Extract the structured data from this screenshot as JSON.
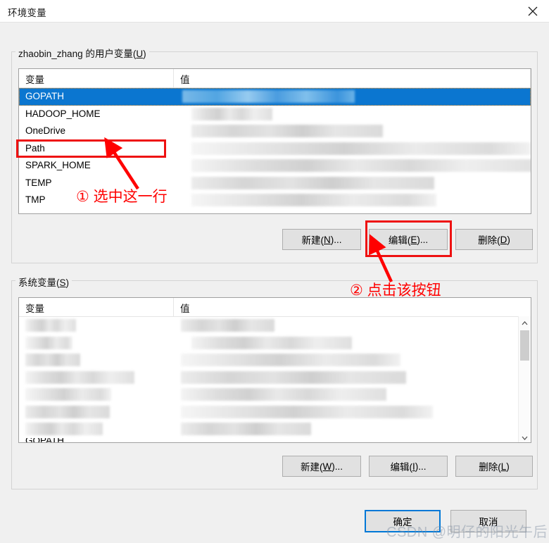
{
  "window": {
    "title": "环境变量",
    "close_icon": "close-icon"
  },
  "user_section": {
    "legend_prefix": "zhaobin_zhang 的用户变量(",
    "legend_accel": "U",
    "legend_suffix": ")",
    "columns": [
      "变量",
      "值"
    ],
    "rows": [
      {
        "name": "GOPATH",
        "value": "",
        "selected": true
      },
      {
        "name": "HADOOP_HOME",
        "value": "",
        "selected": false
      },
      {
        "name": "OneDrive",
        "value": "",
        "selected": false
      },
      {
        "name": "Path",
        "value": "",
        "selected": false
      },
      {
        "name": "SPARK_HOME",
        "value": "",
        "selected": false
      },
      {
        "name": "TEMP",
        "value": "",
        "selected": false
      },
      {
        "name": "TMP",
        "value": "",
        "selected": false
      }
    ],
    "buttons": {
      "new": {
        "prefix": "新建(",
        "accel": "N",
        "suffix": ")..."
      },
      "edit": {
        "prefix": "编辑(",
        "accel": "E",
        "suffix": ")..."
      },
      "delete": {
        "prefix": "删除(",
        "accel": "D",
        "suffix": ")"
      }
    }
  },
  "system_section": {
    "legend_prefix": "系统变量(",
    "legend_accel": "S",
    "legend_suffix": ")",
    "columns": [
      "变量",
      "值"
    ],
    "rows": [
      {
        "name": "",
        "value": "",
        "censored": true
      },
      {
        "name": "",
        "value": "",
        "censored": true
      },
      {
        "name": "",
        "value": "",
        "censored": true
      },
      {
        "name": "",
        "value": "",
        "censored": true
      },
      {
        "name": "",
        "value": "",
        "censored": true
      },
      {
        "name": "",
        "value": "",
        "censored": true
      },
      {
        "name": "GOPATH",
        "value": "",
        "censored": false
      }
    ],
    "buttons": {
      "new": {
        "prefix": "新建(",
        "accel": "W",
        "suffix": ")..."
      },
      "edit": {
        "prefix": "编辑(",
        "accel": "I",
        "suffix": ")..."
      },
      "delete": {
        "prefix": "删除(",
        "accel": "L",
        "suffix": ")"
      }
    },
    "scrollbar": {
      "up_icon": "chevron-up-icon",
      "down_icon": "chevron-down-icon"
    }
  },
  "dialog_buttons": {
    "ok": "确定",
    "cancel": "取消"
  },
  "annotations": {
    "step1": "① 选中这一行",
    "step2": "② 点击该按钮",
    "color": "#ff0000"
  },
  "watermark": {
    "text": "CSDN @明仔的阳光午后"
  },
  "colors": {
    "selection_blue": "#0b76d0",
    "accent_focus": "#0078d7",
    "dialog_bg": "#f0f0f0",
    "button_bg": "#e1e1e1"
  }
}
